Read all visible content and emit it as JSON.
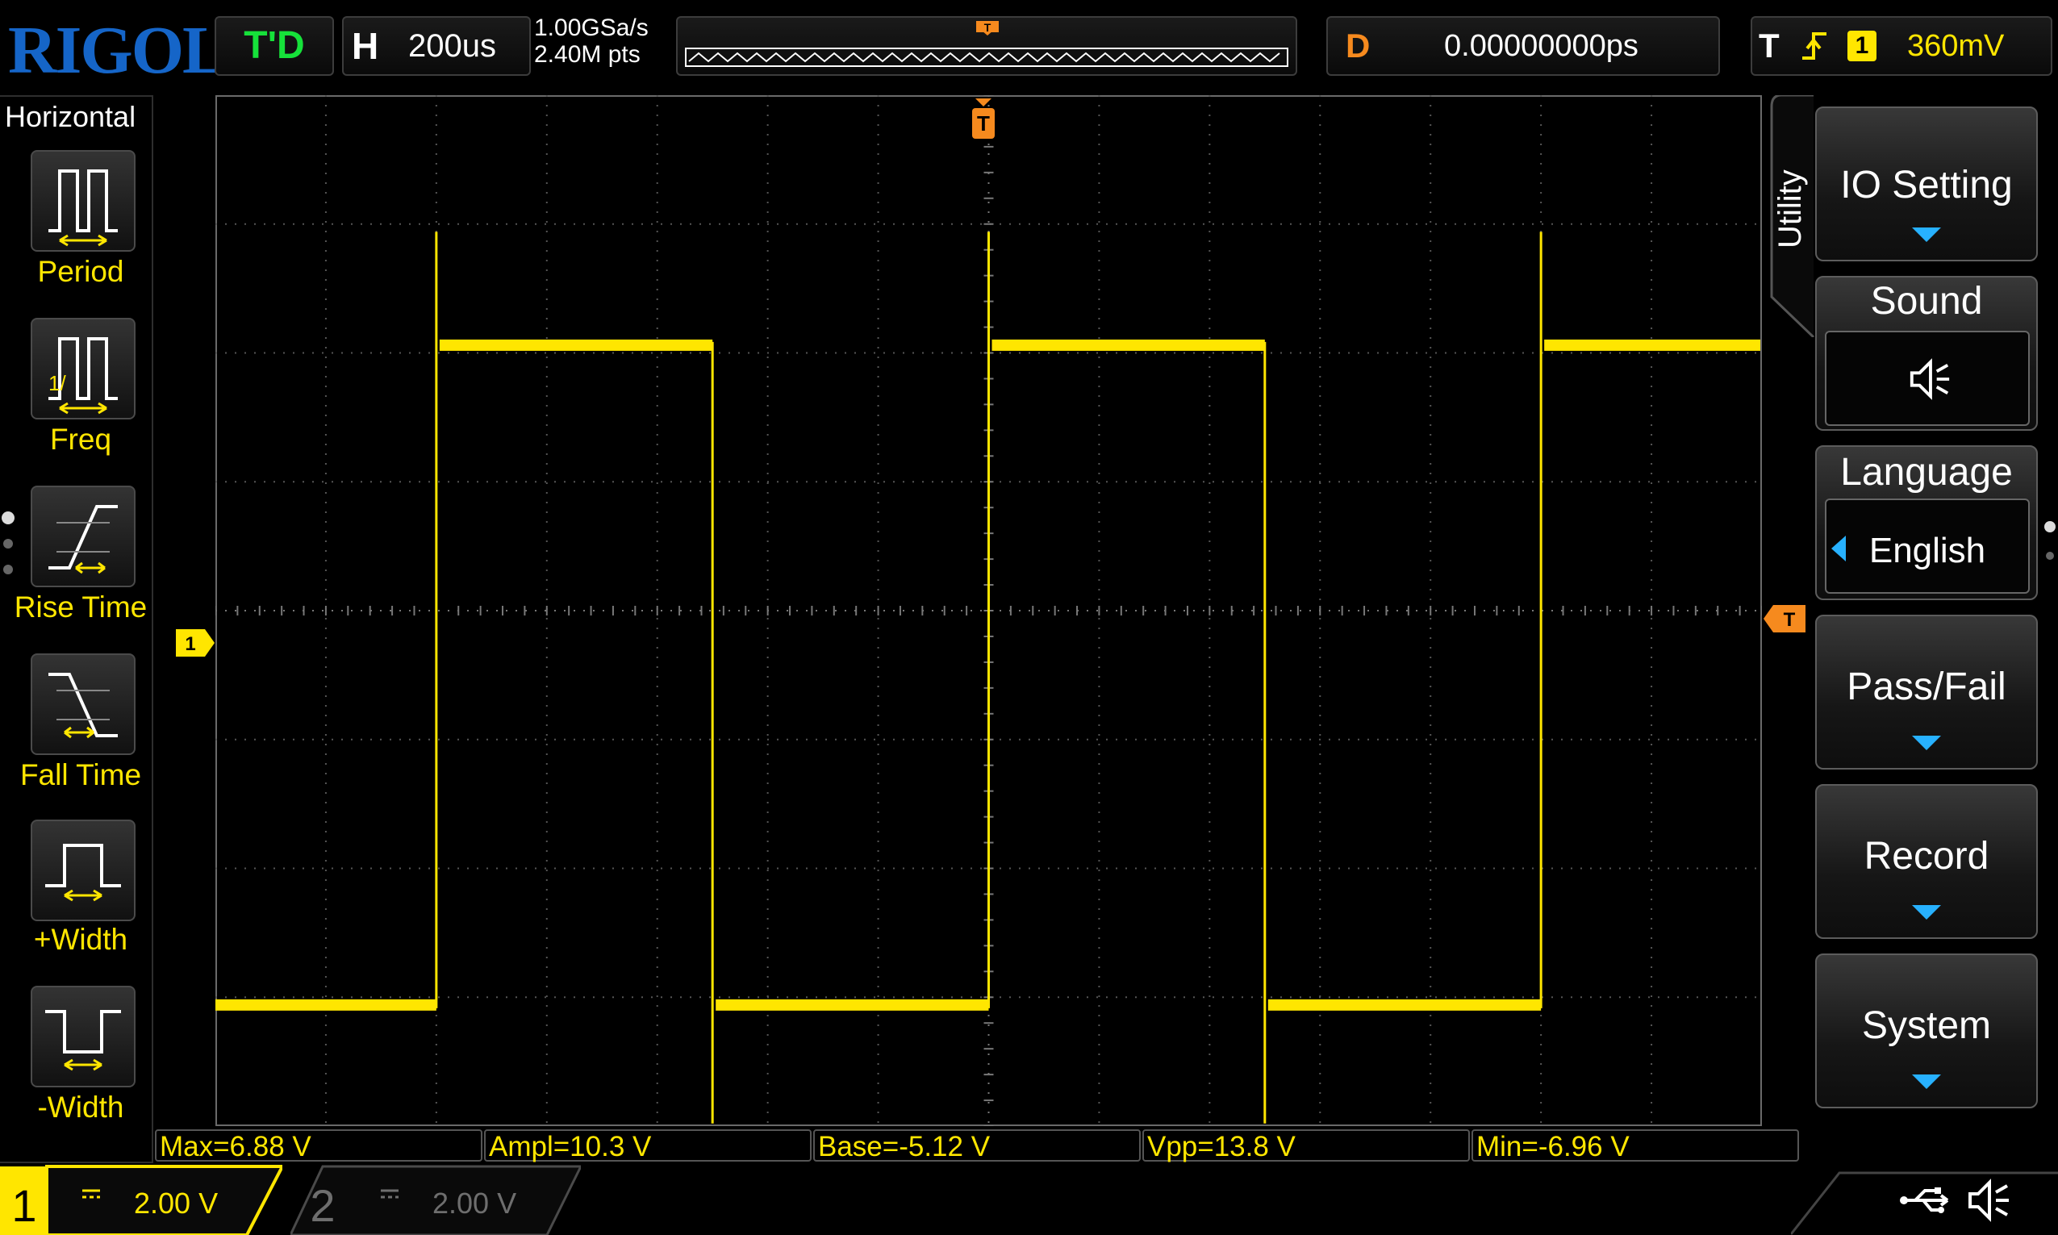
{
  "brand": "RIGOL",
  "run_status": "T'D",
  "horizontal": {
    "label": "H",
    "timebase": "200us"
  },
  "acquisition": {
    "sample_rate": "1.00GSa/s",
    "memory_depth": "2.40M pts"
  },
  "trigger_position_marker": "T",
  "delay": {
    "label": "D",
    "value": "0.00000000ps"
  },
  "trigger": {
    "label": "T",
    "source": "1",
    "level": "360mV",
    "slope": "rising"
  },
  "left_panel": {
    "title": "Horizontal",
    "items": [
      {
        "id": "period",
        "label": "Period",
        "icon": "period-icon"
      },
      {
        "id": "freq",
        "label": "Freq",
        "icon": "freq-icon"
      },
      {
        "id": "rise-time",
        "label": "Rise Time",
        "icon": "rise-time-icon"
      },
      {
        "id": "fall-time",
        "label": "Fall Time",
        "icon": "fall-time-icon"
      },
      {
        "id": "pos-width",
        "label": "+Width",
        "icon": "positive-width-icon"
      },
      {
        "id": "neg-width",
        "label": "-Width",
        "icon": "negative-width-icon"
      }
    ]
  },
  "channel_marker": "1",
  "trigger_level_marker": "T",
  "waveform": {
    "channel": 1,
    "color": "#ffe600",
    "high_level_v": 5.12,
    "low_level_v": -5.12,
    "overshoot_max_v": 6.88,
    "undershoot_min_v": -6.96,
    "volts_per_div": 2.0,
    "offset_divs": -0.5,
    "time_per_div_us": 200,
    "rising_edges_div": [
      2,
      7,
      12
    ],
    "falling_edges_div": [
      4.5,
      9.5
    ]
  },
  "measurements": [
    {
      "id": "max",
      "text": "Max=6.88 V"
    },
    {
      "id": "ampl",
      "text": "Ampl=10.3 V"
    },
    {
      "id": "base",
      "text": "Base=-5.12 V"
    },
    {
      "id": "vpp",
      "text": "Vpp=13.8 V"
    },
    {
      "id": "min",
      "text": "Min=-6.96 V"
    }
  ],
  "channels": [
    {
      "number": "1",
      "coupling": "DC",
      "scale": "2.00 V",
      "color": "#ffe600",
      "active": true
    },
    {
      "number": "2",
      "coupling": "DC",
      "scale": "2.00 V",
      "color": "#7a7a7a",
      "active": false
    }
  ],
  "status_icons": [
    "usb-icon",
    "speaker-icon"
  ],
  "menu": {
    "tab": "Utility",
    "items": [
      {
        "id": "io-setting",
        "label": "IO Setting",
        "has_submenu": true
      },
      {
        "id": "sound",
        "label": "Sound",
        "value_icon": "speaker-icon"
      },
      {
        "id": "language",
        "label": "Language",
        "value": "English"
      },
      {
        "id": "pass-fail",
        "label": "Pass/Fail",
        "has_submenu": true
      },
      {
        "id": "record",
        "label": "Record",
        "has_submenu": true
      },
      {
        "id": "system",
        "label": "System",
        "has_submenu": true
      }
    ]
  },
  "colors": {
    "accent_blue": "#27b1ff",
    "trigger_orange": "#f68a1e",
    "ch1_yellow": "#ffe600",
    "run_green": "#16e23a",
    "brand_blue": "#1565c8"
  }
}
